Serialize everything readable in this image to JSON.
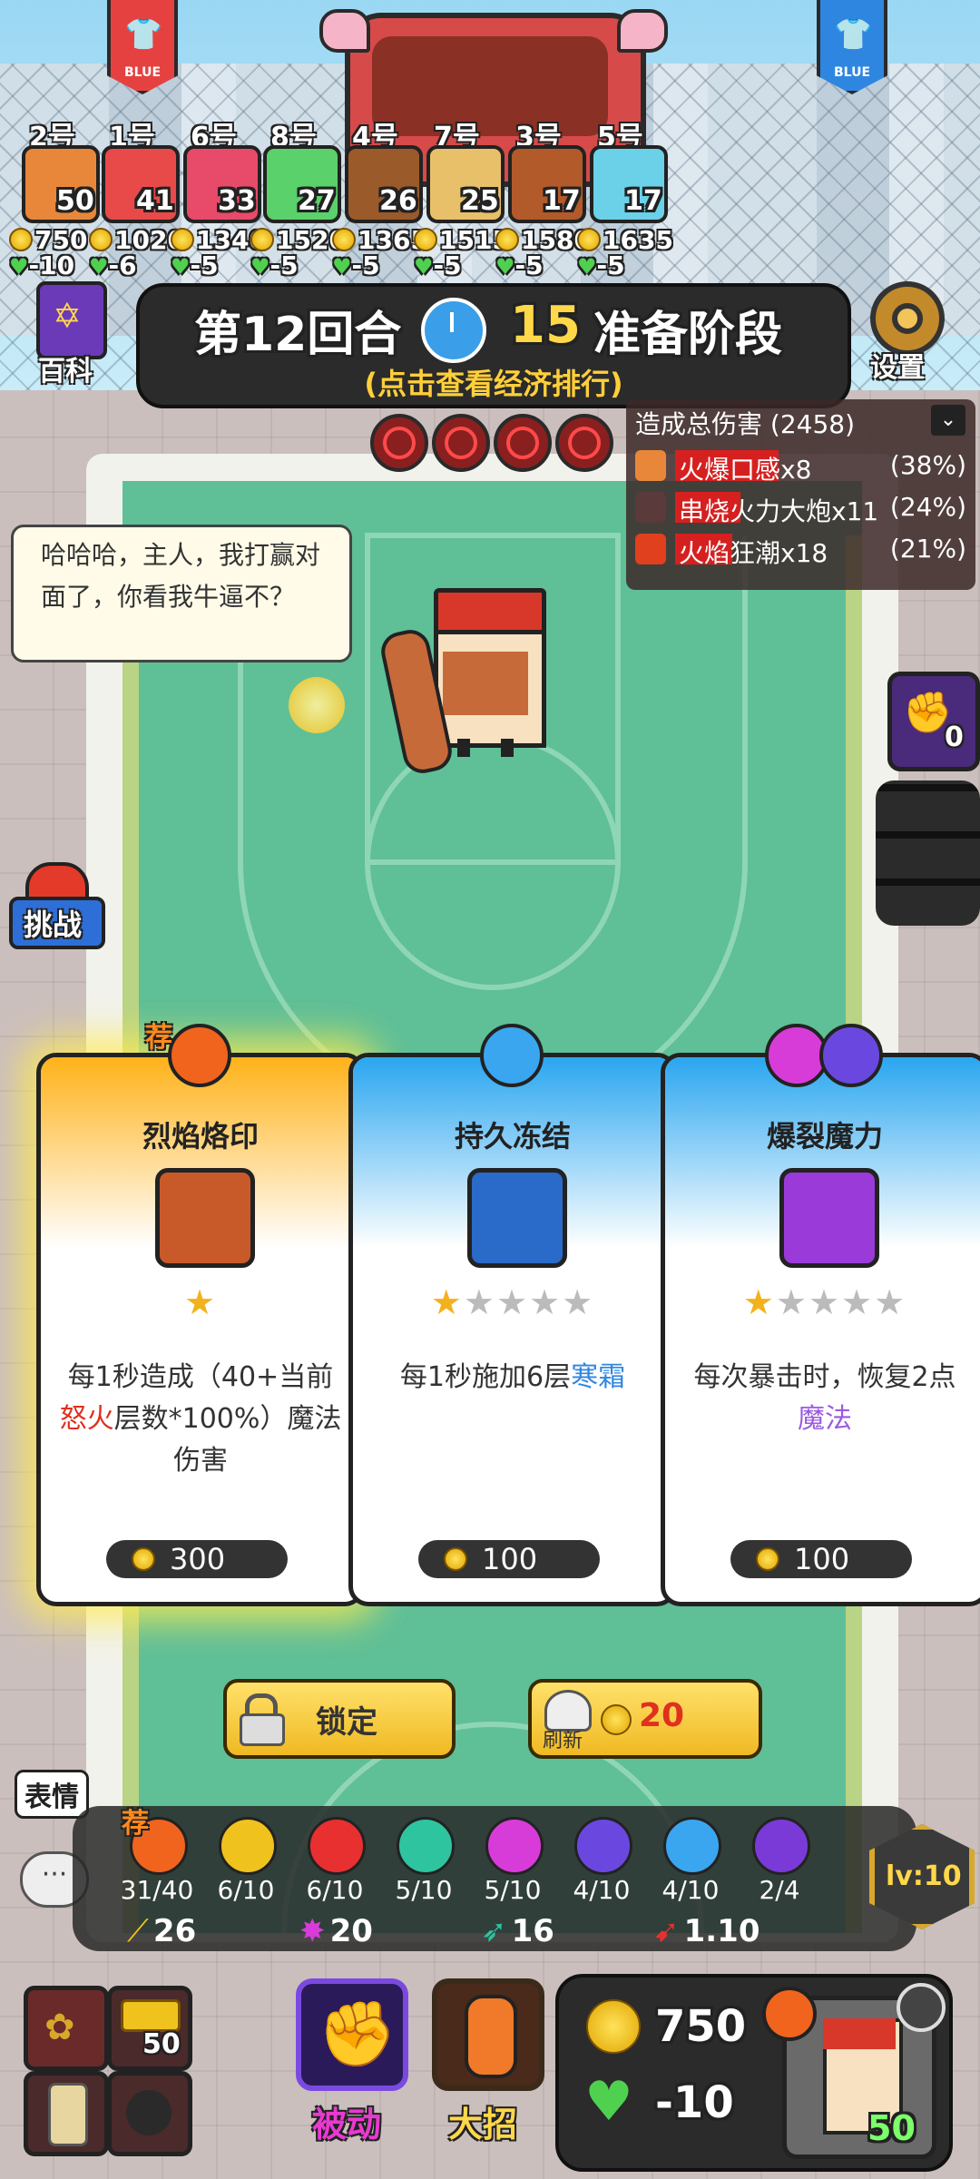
{
  "teams": {
    "left_label": "BLUE",
    "right_label": "BLUE"
  },
  "players": [
    {
      "num": "2号",
      "level": "50",
      "gold": "750",
      "hp": "-10",
      "color": "#e8873a"
    },
    {
      "num": "1号",
      "level": "41",
      "gold": "1020",
      "hp": "-6",
      "color": "#e84a4a"
    },
    {
      "num": "6号",
      "level": "33",
      "gold": "1340",
      "hp": "-5",
      "color": "#e84a6a"
    },
    {
      "num": "8号",
      "level": "27",
      "gold": "1520",
      "hp": "-5",
      "color": "#5ad16a"
    },
    {
      "num": "4号",
      "level": "26",
      "gold": "1365",
      "hp": "-5",
      "color": "#9a5a2a"
    },
    {
      "num": "7号",
      "level": "25",
      "gold": "1515",
      "hp": "-5",
      "color": "#e8c06a"
    },
    {
      "num": "3号",
      "level": "17",
      "gold": "1580",
      "hp": "-5",
      "color": "#b25a2a"
    },
    {
      "num": "5号",
      "level": "17",
      "gold": "1635",
      "hp": "-5",
      "color": "#6ad1e8"
    }
  ],
  "header": {
    "round": "第12回合",
    "timer": "15",
    "phase": "准备阶段",
    "hint": "(点击查看经济排行)",
    "baike": "百科",
    "settings": "设置"
  },
  "damage": {
    "title": "造成总伤害 (2458)",
    "rows": [
      {
        "name": "火爆口感x8",
        "pct": "(38%)",
        "fill": 0.38
      },
      {
        "name": "串烧火力大炮x11",
        "pct": "(24%)",
        "fill": 0.24
      },
      {
        "name": "火焰狂潮x18",
        "pct": "(21%)",
        "fill": 0.21
      }
    ]
  },
  "bubble": {
    "text": "哈哈哈，主人，我打赢对面了，你看我牛逼不？"
  },
  "side": {
    "challenge": "挑战",
    "counter": "0"
  },
  "cards": [
    {
      "tag": "荐",
      "title": "烈焰烙印",
      "stars_filled": 1,
      "stars_total": 1,
      "desc_a": "每1秒造成（40+当前",
      "desc_hl": "怒火",
      "desc_b": "层数*100%）魔法伤害",
      "hl_color": "#e0301e",
      "price": "300",
      "top_color": "#ffb21a"
    },
    {
      "tag": "",
      "title": "持久冻结",
      "stars_filled": 1,
      "stars_total": 5,
      "desc_a": "每1秒施加6层",
      "desc_hl": "寒霜",
      "desc_b": "",
      "hl_color": "#2f86e0",
      "price": "100",
      "top_color": "#2aa6f0"
    },
    {
      "tag": "",
      "title": "爆裂魔力",
      "stars_filled": 1,
      "stars_total": 5,
      "desc_a": "每次暴击时，恢复2点",
      "desc_hl": "魔法",
      "desc_b": "",
      "hl_color": "#9a5ae0",
      "price": "100",
      "top_color": "#2aa6f0"
    }
  ],
  "actions": {
    "lock": "锁定",
    "refresh": "刷新",
    "refresh_cost": "20"
  },
  "emote": {
    "label": "表情",
    "tag": "荐"
  },
  "skills": [
    {
      "count": "31/40",
      "color": "#f0641e",
      "icon": "fire-icon"
    },
    {
      "count": "6/10",
      "color": "#f0c21e",
      "icon": "sword-icon"
    },
    {
      "count": "6/10",
      "color": "#e83030",
      "icon": "heart-icon"
    },
    {
      "count": "5/10",
      "color": "#2ec4a0",
      "icon": "wind-icon"
    },
    {
      "count": "5/10",
      "color": "#d83cd8",
      "icon": "burst-icon"
    },
    {
      "count": "4/10",
      "color": "#6a48e0",
      "icon": "magic-icon"
    },
    {
      "count": "4/10",
      "color": "#3aa6f0",
      "icon": "snowflake-icon"
    },
    {
      "count": "2/4",
      "color": "#7a3ad8",
      "icon": "skull-icon"
    }
  ],
  "stats": {
    "attack": "26",
    "burst": "20",
    "speed": "16",
    "rate": "1.10",
    "level": "lv:10"
  },
  "bottom": {
    "item_count": "50",
    "passive": "被动",
    "ultimate": "大招",
    "gold": "750",
    "hp": "-10",
    "avatar_level": "50"
  }
}
